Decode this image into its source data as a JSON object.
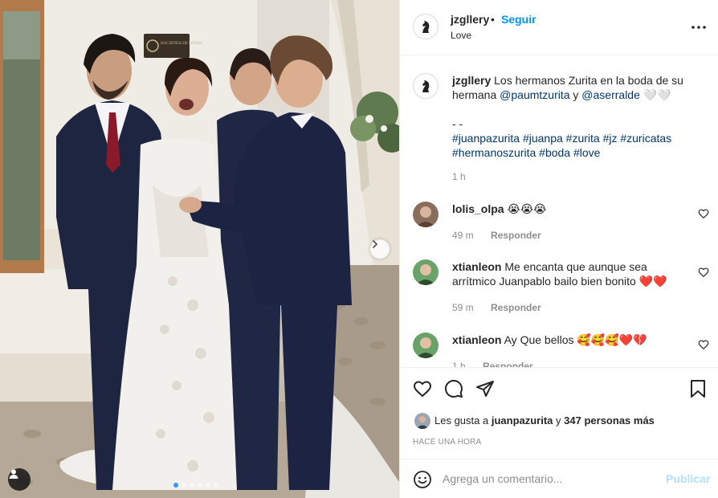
{
  "post": {
    "username": "jzgllery",
    "separator": "•",
    "follow_label": "Seguir",
    "location": "Love",
    "caption_user": "jzgllery",
    "caption_text": "Los hermanos Zurita en la boda de su hermana",
    "caption_mention_1": "@paumtzurita",
    "caption_and": "y",
    "caption_mention_2": "@aserralde",
    "caption_emoji": "🤍🤍",
    "caption_dashes": "- -",
    "hashtags_line_1": "#juanpazurita #juanpa #zurita #jz #zuricatas",
    "hashtags_line_2": "#hermanoszurita #boda #love",
    "caption_time": "1 h"
  },
  "comments": [
    {
      "user": "lolis_olpa",
      "text": "😭😭😭",
      "time": "49 m",
      "reply": "Responder"
    },
    {
      "user": "xtianleon",
      "text": "Me encanta que aunque sea arrítmico Juanpablo bailo bien bonito",
      "emoji": "❤️❤️",
      "time": "59 m",
      "reply": "Responder"
    },
    {
      "user": "xtianleon",
      "text": "Ay Que bellos",
      "emoji": "🥰🥰🥰❤️💔",
      "time": "1 h",
      "reply": "Responder"
    }
  ],
  "likes": {
    "prefix": "Les gusta a",
    "user": "juanpazurita",
    "mid": "y",
    "count": "347 personas más"
  },
  "timestamp": "HACE UNA HORA",
  "composer": {
    "placeholder": "Agrega un comentario...",
    "publish_label": "Publicar"
  },
  "photo": {
    "sign_text": "HACIENDA DE BODAS",
    "carousel_count": 6,
    "carousel_active": 1
  },
  "colors": {
    "accent": "#0095f6",
    "publish_disabled": "#b2dffc",
    "muted": "#8e8e8e",
    "link": "#00376b"
  }
}
